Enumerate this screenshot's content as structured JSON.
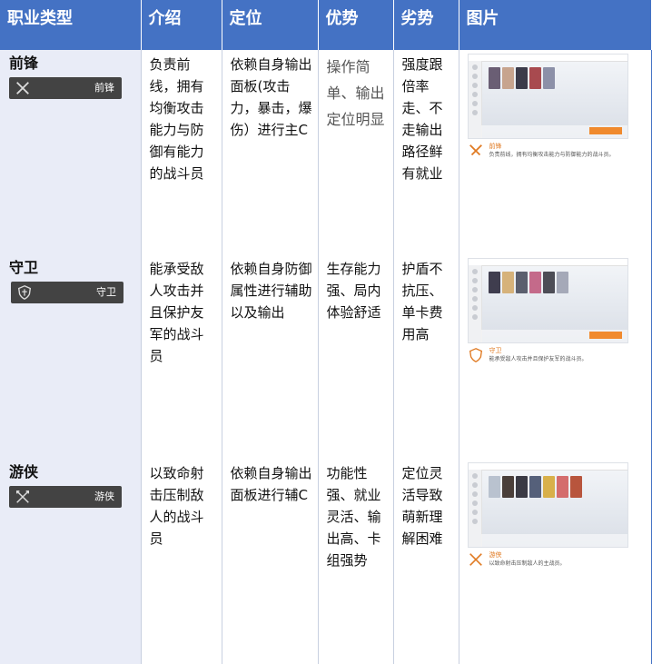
{
  "headers": [
    "职业类型",
    "介绍",
    "定位",
    "优势",
    "劣势",
    "图片"
  ],
  "colors": {
    "header_bg": "#4472c4",
    "type_col_bg": "#e9ecf7",
    "badge_bg": "#434343",
    "accent_orange": "#f08a2e"
  },
  "rows": [
    {
      "type": "前锋",
      "badge_label": "前锋",
      "badge_icon": "crossed-swords-icon",
      "intro": "负责前线，拥有均衡攻击能力与防御有能力的战斗员",
      "position": "依赖自身输出面板(攻击力，暴击，爆伤）进行主C",
      "advantage": "操作简单、输出定位明显",
      "disadvantage": "强度跟倍率走、不走输出路径鲜有就业",
      "caption_title": "前锋",
      "caption_text": "负责前线，拥有均衡攻击能力与防御能力的战斗员。"
    },
    {
      "type": "守卫",
      "badge_label": "守卫",
      "badge_icon": "shield-icon",
      "intro": "能承受敌人攻击并且保护友军的战斗员",
      "position": "依赖自身防御属性进行辅助以及输出",
      "advantage": "生存能力强、局内体验舒适",
      "disadvantage": "护盾不抗压、单卡费用高",
      "caption_title": "守卫",
      "caption_text": "能承受敌人攻击并且保护友军的战斗员。"
    },
    {
      "type": "游侠",
      "badge_label": "游侠",
      "badge_icon": "crossed-arrows-icon",
      "intro": "以致命射击压制敌人的战斗员",
      "position": "依赖自身输出面板进行辅C",
      "advantage": "功能性强、就业灵活、输出高、卡组强势",
      "disadvantage": "定位灵活导致萌新理解困难",
      "caption_title": "游侠",
      "caption_text": "以致命射击压制敌人的主战员。"
    }
  ]
}
